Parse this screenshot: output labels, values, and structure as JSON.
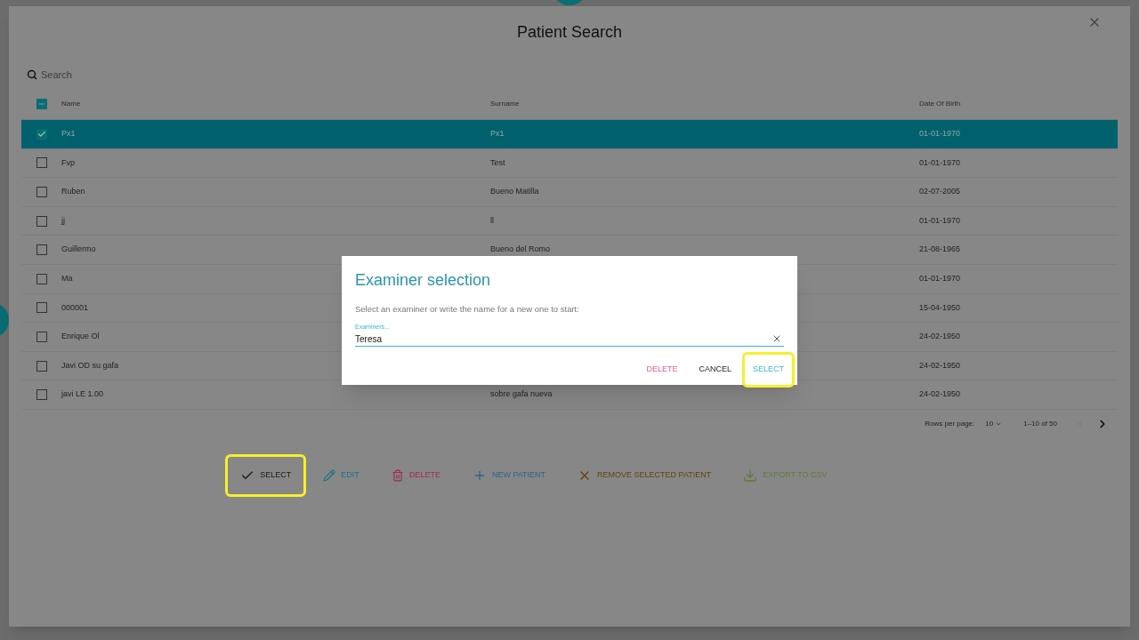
{
  "window": {
    "title": "Patient Search"
  },
  "search": {
    "placeholder": "Search"
  },
  "table": {
    "select_all_indeterminate": true,
    "columns": [
      "Name",
      "Surname",
      "Date Of Birth"
    ],
    "rows": [
      {
        "name": "Px1",
        "surname": "Px1",
        "dob": "01-01-1970",
        "selected": true
      },
      {
        "name": "Fvp",
        "surname": "Test",
        "dob": "01-01-1970",
        "selected": false
      },
      {
        "name": "Ruben",
        "surname": "Bueno Matilla",
        "dob": "02-07-2005",
        "selected": false
      },
      {
        "name": "jj",
        "surname": "ll",
        "dob": "01-01-1970",
        "selected": false
      },
      {
        "name": "Guillermo",
        "surname": "Bueno del Romo",
        "dob": "21-08-1965",
        "selected": false
      },
      {
        "name": "Ma",
        "dob": "01-01-1970",
        "selected": false
      },
      {
        "name": "000001",
        "dob": "15-04-1950",
        "selected": false
      },
      {
        "name": "Enrique Ol",
        "dob": "24-02-1950",
        "selected": false
      },
      {
        "name": "Javi OD su gafa",
        "dob": "24-02-1950",
        "selected": false
      },
      {
        "name": "javi LE 1.00",
        "surname": "sobre gafa nueva",
        "dob": "24-02-1950",
        "selected": false
      }
    ]
  },
  "pagination": {
    "rows_per_page_label": "Rows per page:",
    "rows_per_page": "10",
    "range": "1–10 of 50"
  },
  "actions": [
    {
      "kind": "select",
      "label": "SELECT",
      "highlighted": true
    },
    {
      "kind": "edit",
      "label": "EDIT",
      "highlighted": false
    },
    {
      "kind": "delete",
      "label": "DELETE",
      "highlighted": false
    },
    {
      "kind": "new",
      "label": "NEW PATIENT",
      "highlighted": false
    },
    {
      "kind": "remove",
      "label": "REMOVE SELECTED PATIENT",
      "highlighted": false
    },
    {
      "kind": "export",
      "label": "EXPORT TO CSV",
      "highlighted": false
    }
  ],
  "dialog": {
    "title": "Examiner selection",
    "message": "Select an examiner or write the name for a new one to start:",
    "field_label": "Examiners...",
    "field_value": "Teresa",
    "buttons": [
      {
        "kind": "delete",
        "label": "DELETE",
        "highlighted": false
      },
      {
        "kind": "cancel",
        "label": "CANCEL",
        "highlighted": false
      },
      {
        "kind": "select",
        "label": "SELECT",
        "highlighted": true
      }
    ]
  }
}
